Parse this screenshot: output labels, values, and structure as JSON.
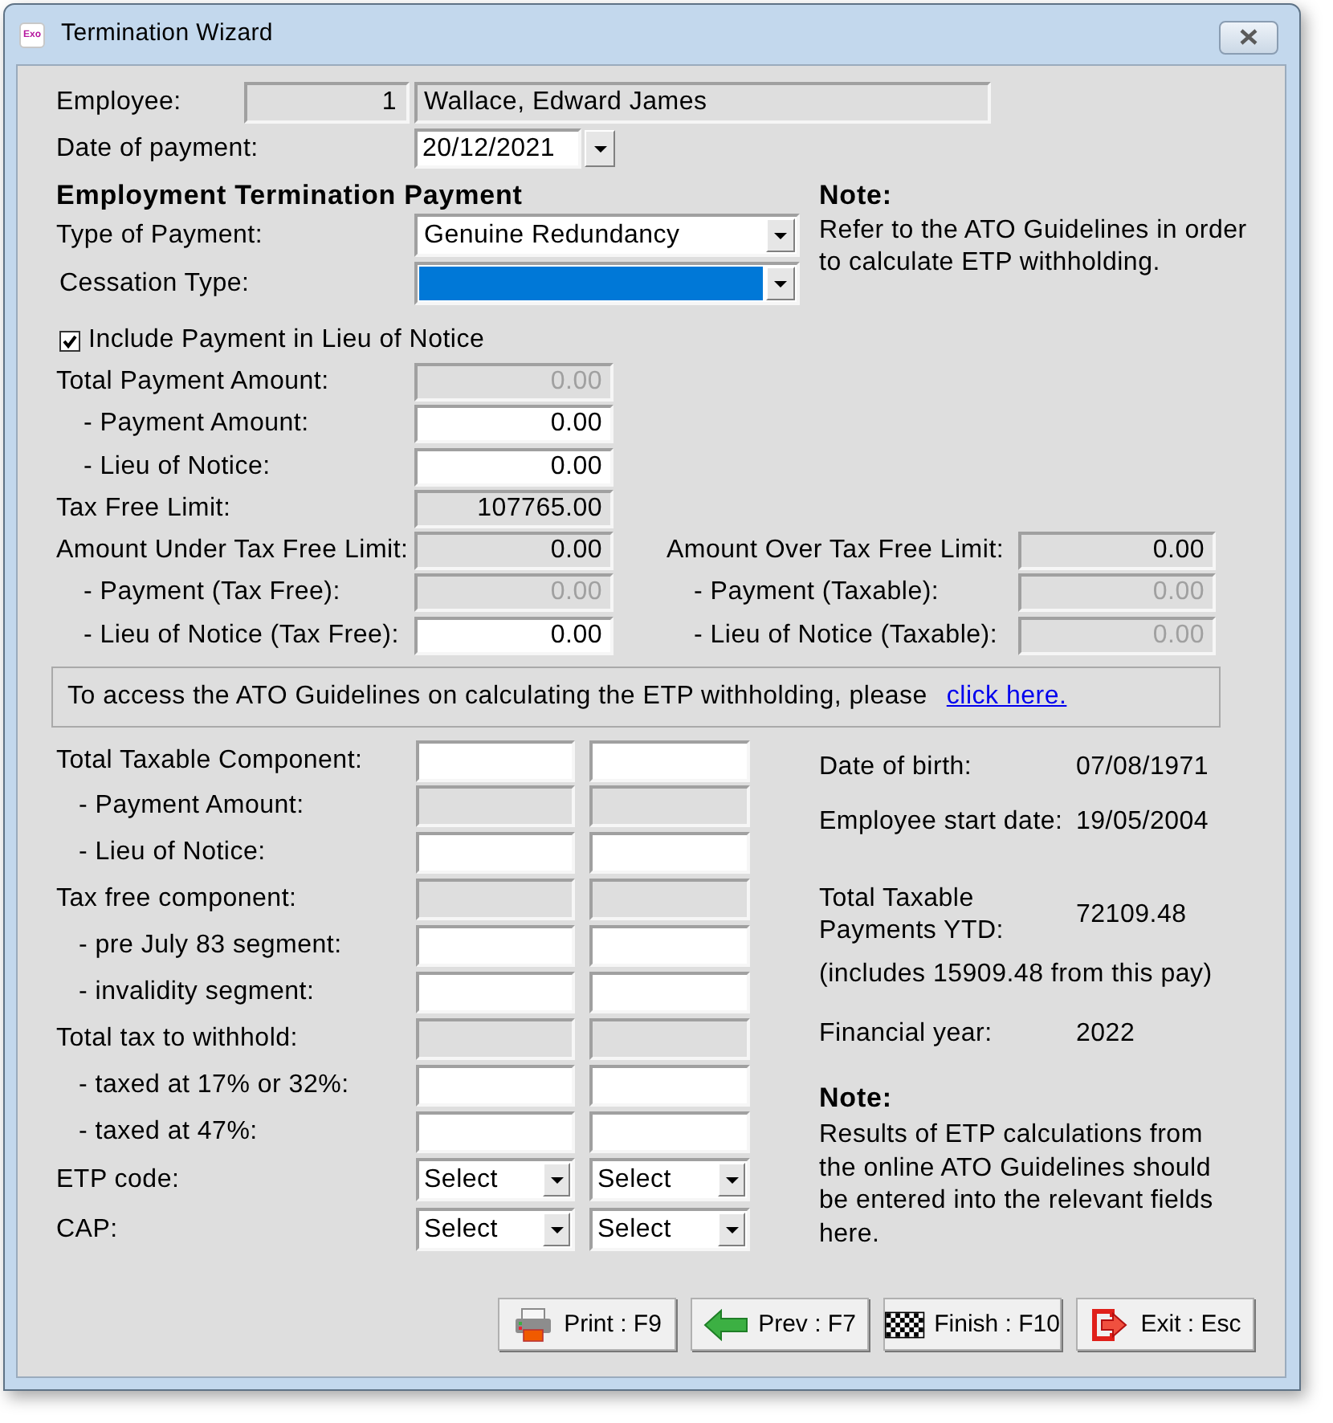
{
  "window": {
    "title": "Termination Wizard",
    "app_icon_text": "Exo"
  },
  "employee": {
    "label": "Employee:",
    "number": "1",
    "name": "Wallace, Edward James"
  },
  "date_of_payment": {
    "label": "Date of payment:",
    "value": "20/12/2021"
  },
  "etp": {
    "heading": "Employment Termination Payment",
    "type_of_payment": {
      "label": "Type of Payment:",
      "value": "Genuine Redundancy"
    },
    "cessation_type": {
      "label": "Cessation Type:",
      "highlighted": true
    }
  },
  "note_top": {
    "heading": "Note:",
    "text": "Refer to the ATO Guidelines in order to calculate ETP withholding."
  },
  "include_lieu": {
    "label": "Include Payment in Lieu of Notice",
    "checked": true
  },
  "amounts_left": [
    {
      "label": "Total Payment Amount:",
      "value": "0.00",
      "kind": "disabled",
      "children": [
        {
          "label": "- Payment Amount:",
          "value": "0.00",
          "kind": "editable"
        },
        {
          "label": "- Lieu of Notice:",
          "value": "0.00",
          "kind": "editable"
        }
      ]
    },
    {
      "label": "Tax Free Limit:",
      "value": "107765.00",
      "kind": "readonly"
    },
    {
      "label": "Amount Under Tax Free Limit:",
      "value": "0.00",
      "kind": "readonly",
      "children": [
        {
          "label": "- Payment (Tax Free):",
          "value": "0.00",
          "kind": "disabled"
        },
        {
          "label": "- Lieu of Notice (Tax Free):",
          "value": "0.00",
          "kind": "editable"
        }
      ]
    }
  ],
  "amounts_right": [
    {
      "label": "Amount Over Tax Free Limit:",
      "value": "0.00",
      "kind": "readonly",
      "children": [
        {
          "label": "- Payment (Taxable):",
          "value": "0.00",
          "kind": "disabled"
        },
        {
          "label": "- Lieu of Notice (Taxable):",
          "value": "0.00",
          "kind": "disabled"
        }
      ]
    }
  ],
  "guidelines_bar": {
    "text": "To access the ATO Guidelines on calculating the ETP withholding, please",
    "link": "click here."
  },
  "components": [
    {
      "label": "Total Taxable Component:",
      "kind": "editable",
      "children": [
        {
          "label": "- Payment Amount:",
          "kind": "readonly"
        },
        {
          "label": "- Lieu of Notice:",
          "kind": "editable"
        }
      ]
    },
    {
      "label": "Tax free component:",
      "kind": "readonly",
      "children": [
        {
          "label": "- pre July 83 segment:",
          "kind": "editable"
        },
        {
          "label": "- invalidity segment:",
          "kind": "editable"
        }
      ]
    },
    {
      "label": "Total tax to withhold:",
      "kind": "readonly",
      "children": [
        {
          "label": "- taxed at 17% or 32%:",
          "kind": "editable"
        },
        {
          "label": "- taxed at 47%:",
          "kind": "editable"
        }
      ]
    },
    {
      "label": "ETP code:",
      "kind": "select",
      "values": [
        "Select",
        "Select"
      ]
    },
    {
      "label": "CAP:",
      "kind": "select",
      "values": [
        "Select",
        "Select"
      ]
    }
  ],
  "details": [
    {
      "label": "Date of birth:",
      "value": "07/08/1971"
    },
    {
      "label": "Employee start date:",
      "value": "19/05/2004"
    },
    {
      "label": "Total Taxable Payments YTD:",
      "value": "72109.48"
    }
  ],
  "ytd_note": "(includes 15909.48 from this pay)",
  "financial_year": {
    "label": "Financial year:",
    "value": "2022"
  },
  "note_bottom": {
    "heading": "Note:",
    "text": "Results of ETP calculations from the online ATO Guidelines should be entered into the relevant fields here."
  },
  "buttons": [
    {
      "label": "Print : F9",
      "kind": "print"
    },
    {
      "label": "Prev : F7",
      "kind": "prev"
    },
    {
      "label": "Finish : F10",
      "kind": "finish"
    },
    {
      "label": "Exit : Esc",
      "kind": "exit"
    }
  ]
}
